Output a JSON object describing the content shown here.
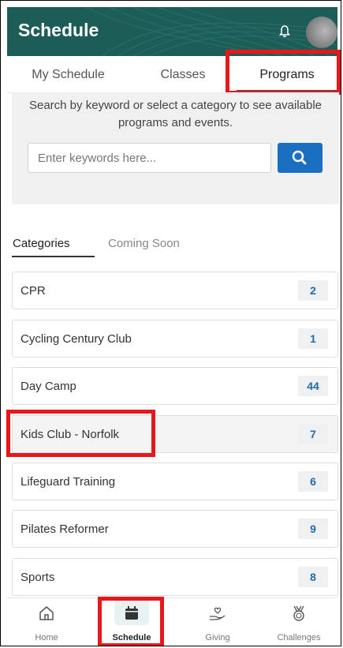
{
  "header": {
    "title": "Schedule",
    "accent_color": "#1d5d58",
    "icons": [
      "bell-icon",
      "avatar"
    ]
  },
  "tabs": [
    {
      "label": "My Schedule",
      "active": false
    },
    {
      "label": "Classes",
      "active": false
    },
    {
      "label": "Programs",
      "active": true
    }
  ],
  "search": {
    "hint": "Search by keyword or select a category to see available programs and events.",
    "placeholder": "Enter keywords here...",
    "button_icon": "search-icon",
    "button_color": "#1b6fc1"
  },
  "category_tabs": [
    {
      "label": "Categories",
      "active": true
    },
    {
      "label": "Coming Soon",
      "active": false
    }
  ],
  "categories": [
    {
      "name": "CPR",
      "count": "2"
    },
    {
      "name": "Cycling Century Club",
      "count": "1"
    },
    {
      "name": "Day Camp",
      "count": "44"
    },
    {
      "name": "Kids Club - Norfolk",
      "count": "7"
    },
    {
      "name": "Lifeguard Training",
      "count": "6"
    },
    {
      "name": "Pilates Reformer",
      "count": "9"
    },
    {
      "name": "Sports",
      "count": "8"
    }
  ],
  "bottom_nav": [
    {
      "label": "Home",
      "icon": "home-icon",
      "active": false
    },
    {
      "label": "Schedule",
      "icon": "calendar-icon",
      "active": true
    },
    {
      "label": "Giving",
      "icon": "hand-heart-icon",
      "active": false
    },
    {
      "label": "Challenges",
      "icon": "medal-icon",
      "active": false
    }
  ],
  "highlight_color": "#e8171b"
}
